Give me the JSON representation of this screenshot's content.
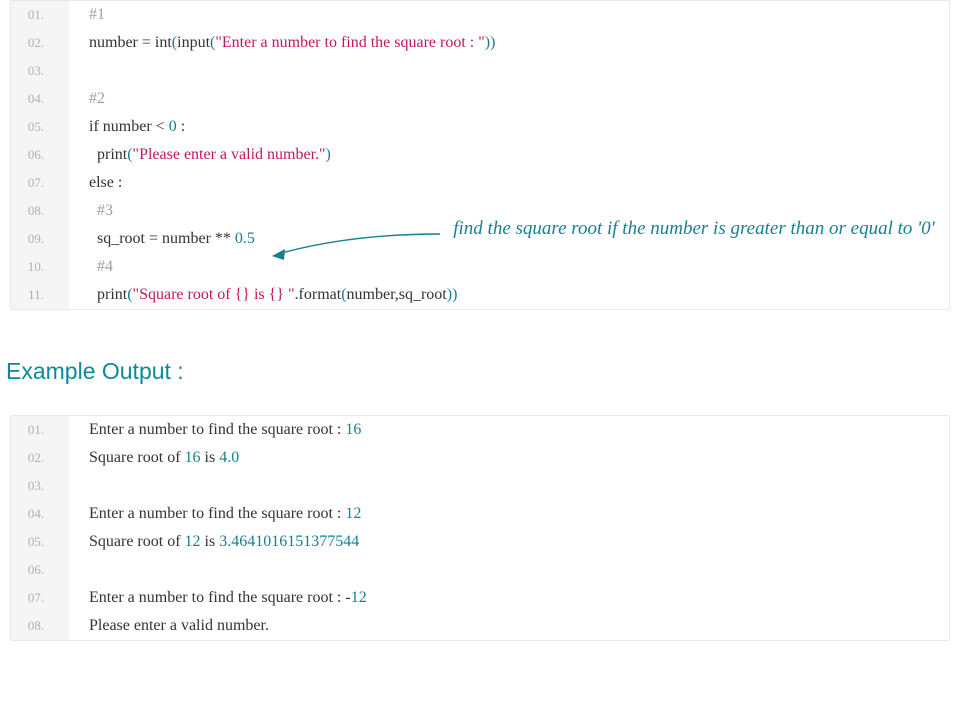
{
  "heading": "Example Output :",
  "annotation": "find the square root if the number is greater than or equal to '0'",
  "code1": {
    "lines": [
      {
        "n": "01.",
        "segs": [
          {
            "t": "#1",
            "c": "tok-comment"
          }
        ]
      },
      {
        "n": "02.",
        "segs": [
          {
            "t": "number ",
            "c": "tok-ident"
          },
          {
            "t": "= ",
            "c": "tok-op"
          },
          {
            "t": "int",
            "c": "tok-ident"
          },
          {
            "t": "(",
            "c": "tok-paren"
          },
          {
            "t": "input",
            "c": "tok-ident"
          },
          {
            "t": "(",
            "c": "tok-paren"
          },
          {
            "t": "\"Enter a number to find the square root : \"",
            "c": "tok-string"
          },
          {
            "t": ")",
            "c": "tok-paren"
          },
          {
            "t": ")",
            "c": "tok-paren"
          }
        ]
      },
      {
        "n": "03.",
        "segs": []
      },
      {
        "n": "04.",
        "segs": [
          {
            "t": "#2",
            "c": "tok-comment"
          }
        ]
      },
      {
        "n": "05.",
        "segs": [
          {
            "t": "if",
            "c": "tok-keyword"
          },
          {
            "t": " number ",
            "c": "tok-ident"
          },
          {
            "t": "<",
            "c": "tok-op"
          },
          {
            "t": " 0 ",
            "c": "tok-number"
          },
          {
            "t": ":",
            "c": "tok-op"
          }
        ]
      },
      {
        "n": "06.",
        "segs": [
          {
            "t": "  ",
            "c": ""
          },
          {
            "t": "print",
            "c": "tok-ident"
          },
          {
            "t": "(",
            "c": "tok-paren"
          },
          {
            "t": "\"Please enter a valid number.\"",
            "c": "tok-string"
          },
          {
            "t": ")",
            "c": "tok-paren"
          }
        ]
      },
      {
        "n": "07.",
        "segs": [
          {
            "t": "else",
            "c": "tok-keyword"
          },
          {
            "t": " :",
            "c": "tok-op"
          }
        ]
      },
      {
        "n": "08.",
        "segs": [
          {
            "t": "  ",
            "c": ""
          },
          {
            "t": "#3",
            "c": "tok-comment"
          }
        ]
      },
      {
        "n": "09.",
        "segs": [
          {
            "t": "  sq_root ",
            "c": "tok-ident"
          },
          {
            "t": "= ",
            "c": "tok-op"
          },
          {
            "t": "number ",
            "c": "tok-ident"
          },
          {
            "t": "** ",
            "c": "tok-op"
          },
          {
            "t": "0.5",
            "c": "tok-number"
          }
        ]
      },
      {
        "n": "10.",
        "segs": [
          {
            "t": "  ",
            "c": ""
          },
          {
            "t": "#4",
            "c": "tok-comment"
          }
        ]
      },
      {
        "n": "11.",
        "segs": [
          {
            "t": "  ",
            "c": ""
          },
          {
            "t": "print",
            "c": "tok-ident"
          },
          {
            "t": "(",
            "c": "tok-paren"
          },
          {
            "t": "\"Square root of {} is {} \"",
            "c": "tok-string"
          },
          {
            "t": ".format",
            "c": "tok-ident"
          },
          {
            "t": "(",
            "c": "tok-paren"
          },
          {
            "t": "number,sq_root",
            "c": "tok-ident"
          },
          {
            "t": ")",
            "c": "tok-paren"
          },
          {
            "t": ")",
            "c": "tok-paren"
          }
        ]
      }
    ]
  },
  "code2": {
    "lines": [
      {
        "n": "01.",
        "segs": [
          {
            "t": "Enter a number to find the square root : ",
            "c": "tok-ident"
          },
          {
            "t": "16",
            "c": "tok-number"
          }
        ]
      },
      {
        "n": "02.",
        "segs": [
          {
            "t": "Square root of ",
            "c": "tok-ident"
          },
          {
            "t": "16",
            "c": "tok-number"
          },
          {
            "t": " is ",
            "c": "tok-ident"
          },
          {
            "t": "4.0",
            "c": "tok-number"
          }
        ]
      },
      {
        "n": "03.",
        "segs": []
      },
      {
        "n": "04.",
        "segs": [
          {
            "t": "Enter a number to find the square root : ",
            "c": "tok-ident"
          },
          {
            "t": "12",
            "c": "tok-number"
          }
        ]
      },
      {
        "n": "05.",
        "segs": [
          {
            "t": "Square root of ",
            "c": "tok-ident"
          },
          {
            "t": "12",
            "c": "tok-number"
          },
          {
            "t": " is ",
            "c": "tok-ident"
          },
          {
            "t": "3.4641016151377544",
            "c": "tok-number"
          }
        ]
      },
      {
        "n": "06.",
        "segs": []
      },
      {
        "n": "07.",
        "segs": [
          {
            "t": "Enter a number to find the square root : ",
            "c": "tok-ident"
          },
          {
            "t": "-",
            "c": "tok-op"
          },
          {
            "t": "12",
            "c": "tok-number"
          }
        ]
      },
      {
        "n": "08.",
        "segs": [
          {
            "t": "Please enter a valid number.",
            "c": "tok-ident"
          }
        ]
      }
    ]
  }
}
